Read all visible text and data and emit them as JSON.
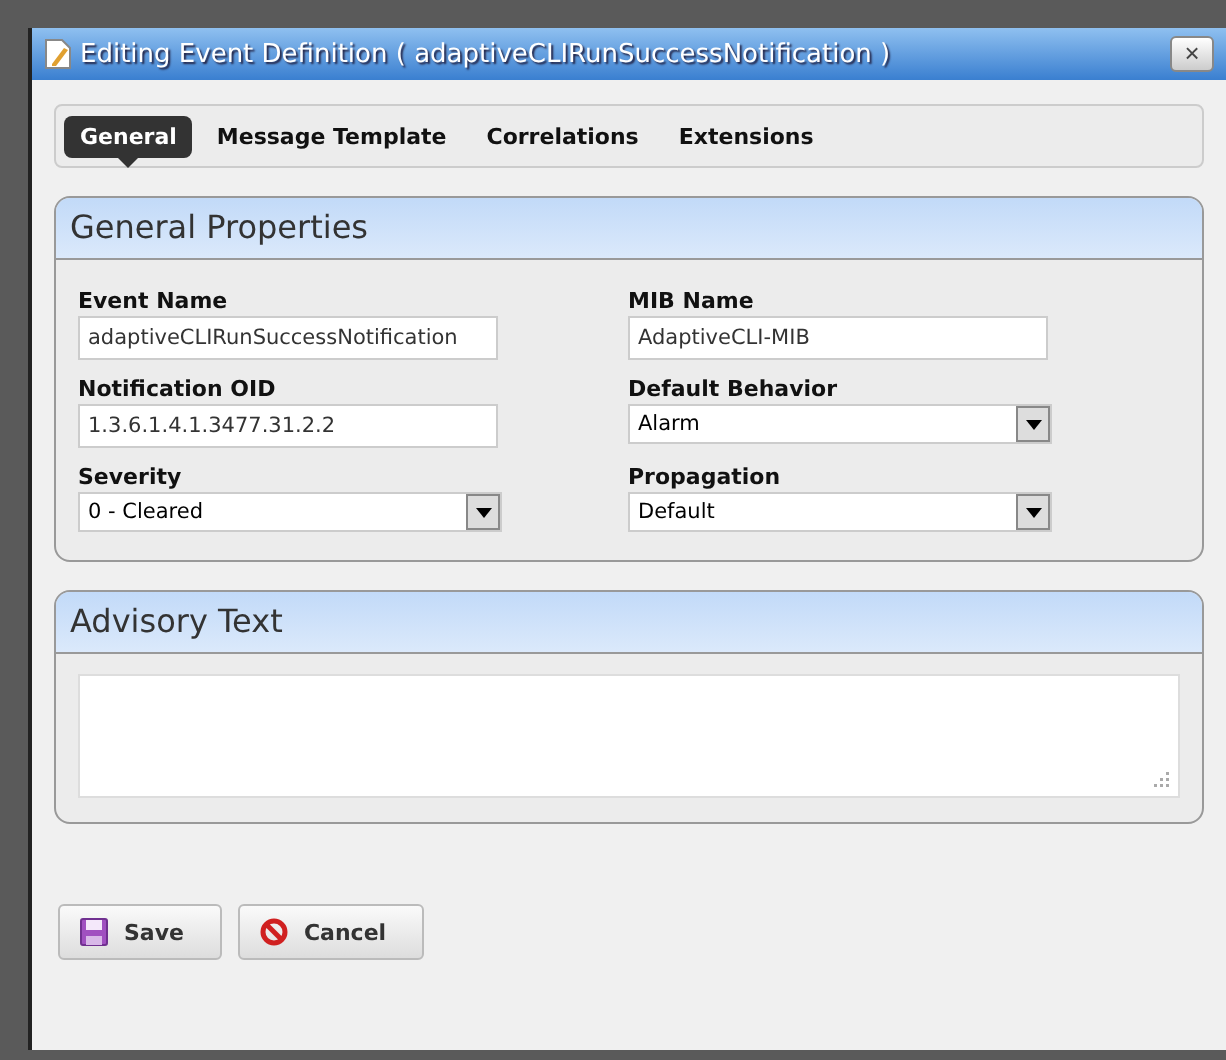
{
  "window": {
    "title": "Editing Event Definition ( adaptiveCLIRunSuccessNotification )",
    "close_label": "×"
  },
  "tabs": [
    {
      "label": "General",
      "selected": true
    },
    {
      "label": "Message Template",
      "selected": false
    },
    {
      "label": "Correlations",
      "selected": false
    },
    {
      "label": "Extensions",
      "selected": false
    }
  ],
  "general_properties": {
    "title": "General Properties",
    "fields": [
      {
        "kind": "text",
        "label": "Event Name",
        "value": "adaptiveCLIRunSuccessNotification"
      },
      {
        "kind": "text",
        "label": "MIB Name",
        "value": "AdaptiveCLI-MIB"
      },
      {
        "kind": "text",
        "label": "Notification OID",
        "value": "1.3.6.1.4.1.3477.31.2.2"
      },
      {
        "kind": "select",
        "label": "Default Behavior",
        "value": "Alarm"
      },
      {
        "kind": "select",
        "label": "Severity",
        "value": "0 - Cleared"
      },
      {
        "kind": "select",
        "label": "Propagation",
        "value": "Default"
      }
    ]
  },
  "advisory_text": {
    "title": "Advisory Text"
  },
  "buttons": [
    {
      "kind": "save",
      "label": "Save"
    },
    {
      "kind": "cancel",
      "label": "Cancel"
    }
  ]
}
